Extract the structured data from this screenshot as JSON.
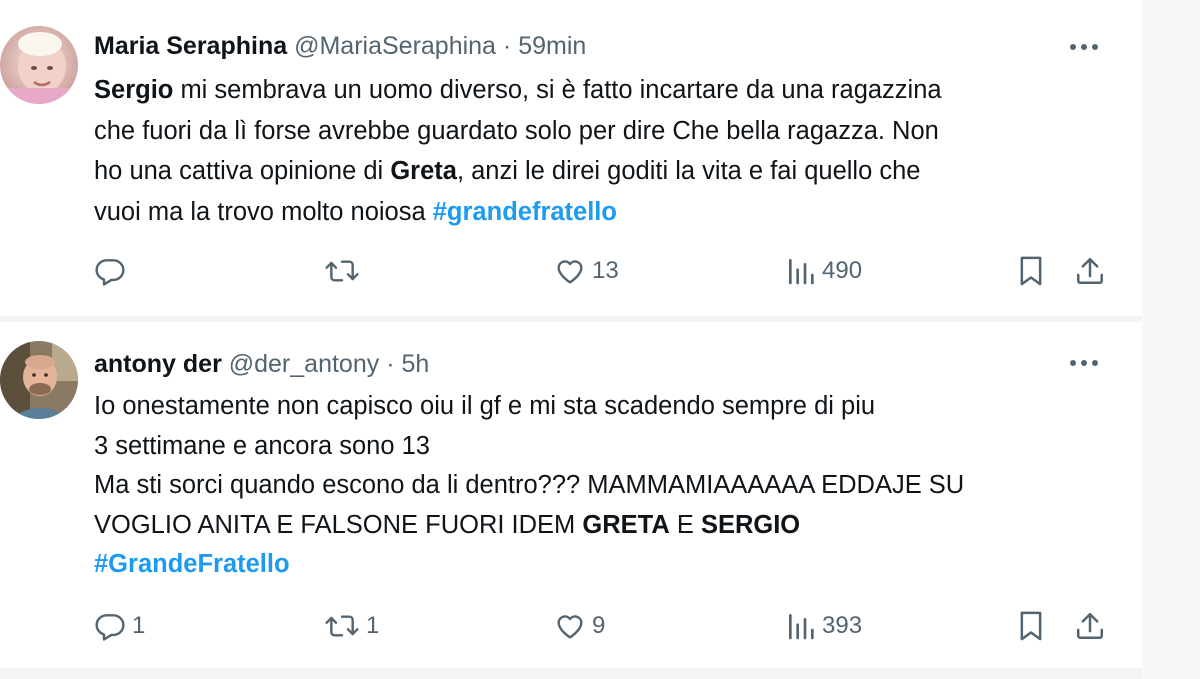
{
  "tweets": [
    {
      "display_name": "Maria Seraphina",
      "handle": "@MariaSeraphina",
      "separator": "·",
      "time": "59min",
      "body_lines": [
        [
          {
            "text": "Sergio",
            "bold": true
          },
          {
            "text": " mi sembrava un uomo diverso, si è fatto incartare da una ragazzina"
          }
        ],
        [
          {
            "text": "che fuori da lì forse avrebbe guardato solo per dire Che bella ragazza. Non"
          }
        ],
        [
          {
            "text": "ho una cattiva opinione di "
          },
          {
            "text": "Greta",
            "bold": true
          },
          {
            "text": ", anzi le direi goditi la vita e fai quello che"
          }
        ],
        [
          {
            "text": "vuoi ma la trovo  molto noiosa "
          },
          {
            "text": "#grandefratello",
            "hashtag": true
          }
        ]
      ],
      "actions": {
        "reply_count": "",
        "retweet_count": "",
        "like_count": "13",
        "view_count": "490"
      }
    },
    {
      "display_name": "antony der",
      "handle": "@der_antony",
      "separator": "·",
      "time": "5h",
      "body_lines": [
        [
          {
            "text": "Io onestamente non capisco oiu il gf e mi sta scadendo sempre di piu"
          }
        ],
        [
          {
            "text": "3 settimane e ancora sono 13"
          }
        ],
        [
          {
            "text": "Ma sti sorci quando escono da li dentro??? MAMMAMIAAAAAA EDDAJE SU"
          }
        ],
        [
          {
            "text": "VOGLIO ANITA E FALSONE FUORI IDEM "
          },
          {
            "text": "GRETA",
            "bold": true
          },
          {
            "text": " E "
          },
          {
            "text": "SERGIO",
            "bold": true
          }
        ],
        [
          {
            "text": "#GrandeFratello",
            "hashtag": true
          }
        ]
      ],
      "actions": {
        "reply_count": "1",
        "retweet_count": "1",
        "like_count": "9",
        "view_count": "393"
      }
    }
  ],
  "icons": {
    "more": "more-horizontal-icon",
    "reply": "reply-bubble-icon",
    "retweet": "retweet-icon",
    "like": "heart-icon",
    "views": "views-bar-chart-icon",
    "bookmark": "bookmark-icon",
    "share": "share-upload-icon"
  },
  "colors": {
    "text_primary": "#0f1419",
    "text_secondary": "#536471",
    "hashtag": "#1d9bf0",
    "divider": "#eff3f4"
  }
}
